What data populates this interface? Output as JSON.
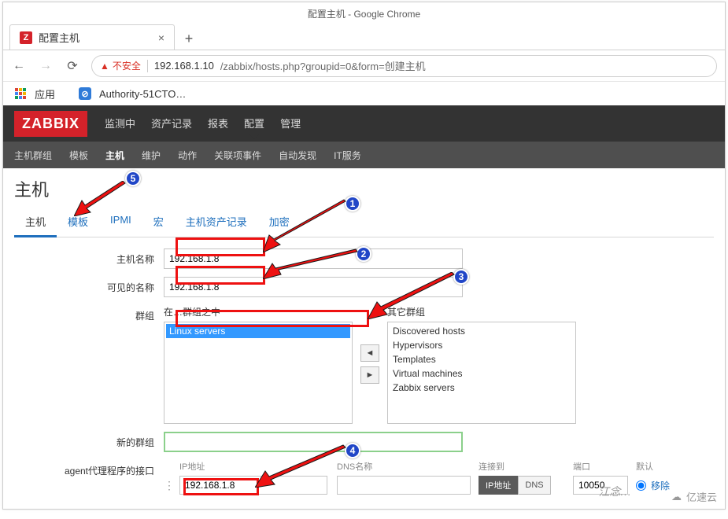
{
  "browser": {
    "window_title": "配置主机 - Google Chrome",
    "tab_title": "配置主机",
    "insecure_label": "不安全",
    "url_host": "192.168.1.10",
    "url_path": "/zabbix/hosts.php?groupid=0&form=创建主机",
    "apps_label": "应用",
    "bookmark1": "Authority-51CTO…"
  },
  "zabbix": {
    "logo": "ZABBIX",
    "nav": [
      "监测中",
      "资产记录",
      "报表",
      "配置",
      "管理"
    ],
    "nav_active_index": 3,
    "subnav": [
      "主机群组",
      "模板",
      "主机",
      "维护",
      "动作",
      "关联项事件",
      "自动发现",
      "IT服务"
    ],
    "subnav_active_index": 2,
    "page_title": "主机",
    "form_tabs": [
      "主机",
      "模板",
      "IPMI",
      "宏",
      "主机资产记录",
      "加密"
    ],
    "form_tabs_active_index": 0,
    "labels": {
      "hostname": "主机名称",
      "visible_name": "可见的名称",
      "groups": "群组",
      "in_groups": "在…群组之中",
      "other_groups": "其它群组",
      "new_group": "新的群组",
      "agent_if": "agent代理程序的接口",
      "ip": "IP地址",
      "dns": "DNS名称",
      "connect_to": "连接到",
      "port": "端口",
      "default": "默认",
      "remove": "移除",
      "seg_ip": "IP地址",
      "seg_dns": "DNS"
    },
    "values": {
      "hostname": "192.168.1.8",
      "visible_name": "192.168.1.8",
      "selected_group": "Linux servers",
      "other_groups": [
        "Discovered hosts",
        "Hypervisors",
        "Templates",
        "Virtual machines",
        "Zabbix servers"
      ],
      "new_group": "",
      "if_ip": "192.168.1.8",
      "if_dns": "",
      "if_port": "10050"
    }
  },
  "annotations": {
    "author": "江念…",
    "brand": "亿速云"
  }
}
